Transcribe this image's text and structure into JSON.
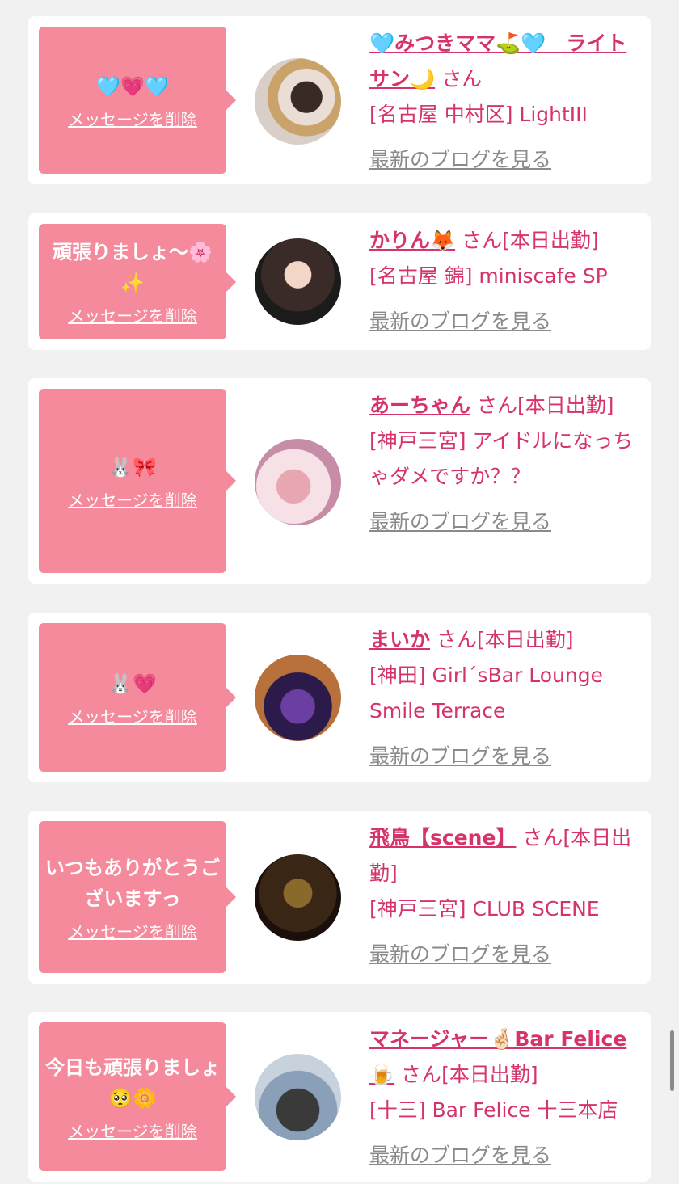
{
  "colors": {
    "background": "#f1f1f1",
    "card": "#ffffff",
    "bubble": "#f48a9b",
    "accent_pink": "#d6336c",
    "link_gray": "#8a8a8a"
  },
  "delete_label": "メッセージを削除",
  "blog_label": "最新のブログを見る",
  "cards": [
    {
      "message": "🩵💗🩵",
      "name": "🩵みつきママ⛳🩵　ライトサン🌙",
      "suffix": "さん",
      "shop": "[名古屋 中村区] LightIII"
    },
    {
      "message": "頑張りましょ〜🌸✨",
      "name": "かりん🦊",
      "suffix": "さん[本日出勤]",
      "shop": "[名古屋 錦] miniscafe SP"
    },
    {
      "message": "🐰🎀",
      "name": "あーちゃん",
      "suffix": "さん[本日出勤]",
      "shop": "[神戸三宮] アイドルになっちゃダメですか？？"
    },
    {
      "message": "🐰💗",
      "name": "まいか",
      "suffix": "さん[本日出勤]",
      "shop": "[神田] Girl´sBar Lounge Smile Terrace"
    },
    {
      "message": "いつもありがとうございますっ",
      "name": "飛鳥【scene】",
      "suffix": "さん[本日出勤]",
      "shop": "[神戸三宮] CLUB SCENE"
    },
    {
      "message": "今日も頑張りましょ🥺🌼",
      "name": "マネージャー🤞🏻Bar Felice🍺",
      "suffix": "さん[本日出勤]",
      "shop": "[十三] Bar Felice 十三本店"
    }
  ]
}
